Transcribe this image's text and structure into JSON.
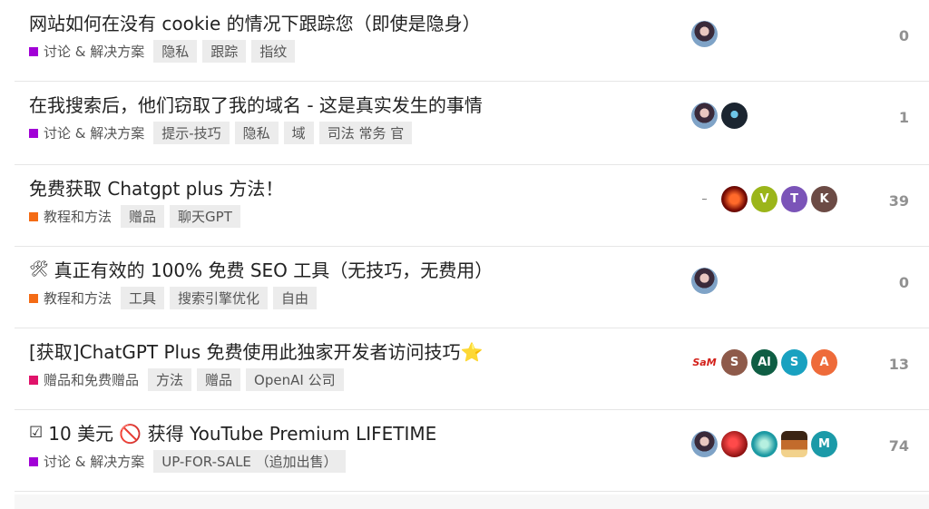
{
  "topics": [
    {
      "title": "网站如何在没有 cookie 的情况下跟踪您（即使是隐身）",
      "prefix_icon": "",
      "category": {
        "label": "讨论 & 解决方案",
        "color": "#a100d6"
      },
      "tags": [
        "隐私",
        "跟踪",
        "指纹"
      ],
      "posters": [
        {
          "kind": "avatar-girl",
          "letter": "",
          "color": "#6b8fb5"
        }
      ],
      "replies": "0"
    },
    {
      "title": "在我搜索后，他们窃取了我的域名 - 这是真实发生的事情",
      "prefix_icon": "",
      "category": {
        "label": "讨论 & 解决方案",
        "color": "#a100d6"
      },
      "tags": [
        "提示-技巧",
        "隐私",
        "域",
        "司法 常务 官"
      ],
      "posters": [
        {
          "kind": "avatar-girl",
          "letter": "",
          "color": "#6b8fb5"
        },
        {
          "kind": "avatar-dark",
          "letter": "",
          "color": "#1b2530"
        }
      ],
      "replies": "1"
    },
    {
      "title": "免费获取 Chatgpt plus 方法！",
      "prefix_icon": "",
      "category": {
        "label": "教程和方法",
        "color": "#f46b15"
      },
      "tags": [
        "赠品",
        "聊天GPT"
      ],
      "posters": [
        {
          "kind": "avatar-sign",
          "letter": "",
          "color": "#ffffff"
        },
        {
          "kind": "avatar-red",
          "letter": "",
          "color": "#b0180c"
        },
        {
          "kind": "letter",
          "letter": "V",
          "color": "#9bb51a"
        },
        {
          "kind": "letter",
          "letter": "T",
          "color": "#7b54b8"
        },
        {
          "kind": "letter",
          "letter": "K",
          "color": "#6c4b45"
        }
      ],
      "replies": "39"
    },
    {
      "title": "真正有效的 100% 免费 SEO 工具（无技巧，无费用）",
      "prefix_icon": "🛠",
      "category": {
        "label": "教程和方法",
        "color": "#f46b15"
      },
      "tags": [
        "工具",
        "搜索引擎优化",
        "自由"
      ],
      "posters": [
        {
          "kind": "avatar-girl",
          "letter": "",
          "color": "#6b8fb5"
        }
      ],
      "replies": "0"
    },
    {
      "title": "[获取]ChatGPT Plus 免费使用此独家开发者访问技巧⭐",
      "prefix_icon": "",
      "category": {
        "label": "赠品和免费赠品",
        "color": "#e0136a"
      },
      "tags": [
        "方法",
        "赠品",
        "OpenAI 公司"
      ],
      "posters": [
        {
          "kind": "avatar-sam",
          "letter": "SaM",
          "color": "#ffffff"
        },
        {
          "kind": "letter",
          "letter": "S",
          "color": "#8e5a4a"
        },
        {
          "kind": "letter",
          "letter": "Al",
          "color": "#0f5e44"
        },
        {
          "kind": "letter",
          "letter": "S",
          "color": "#19a1c0"
        },
        {
          "kind": "letter",
          "letter": "A",
          "color": "#ee6b3a"
        }
      ],
      "replies": "13"
    },
    {
      "title": "10 美元 🚫 获得 YouTube Premium LIFETIME",
      "prefix_icon": "☑",
      "category": {
        "label": "讨论 & 解决方案",
        "color": "#a100d6"
      },
      "tags": [
        "UP-FOR-SALE （追加出售）"
      ],
      "posters": [
        {
          "kind": "avatar-girl",
          "letter": "",
          "color": "#6b8fb5"
        },
        {
          "kind": "avatar-red2",
          "letter": "",
          "color": "#a41b1b"
        },
        {
          "kind": "avatar-teal",
          "letter": "",
          "color": "#1d9aa3"
        },
        {
          "kind": "avatar-pixel",
          "letter": "",
          "color": "#c26b2c"
        },
        {
          "kind": "letter",
          "letter": "M",
          "color": "#1b9aa8"
        }
      ],
      "replies": "74"
    }
  ]
}
